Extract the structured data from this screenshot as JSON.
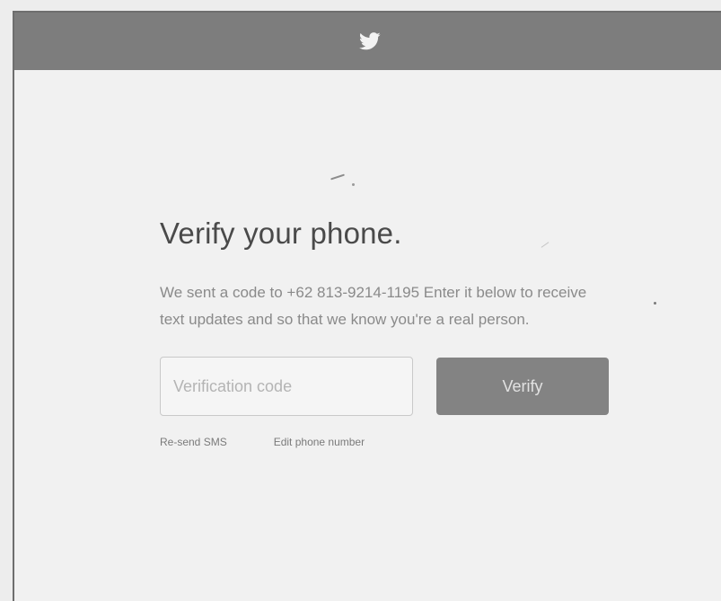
{
  "header": {
    "logo_icon": "twitter-bird-icon",
    "bar_color": "#7d7d7d"
  },
  "verify": {
    "title": "Verify your phone.",
    "description": "We sent a code to +62 813-9214-1195  Enter it below to receive text updates and so that we know you're a real person.",
    "code_input": {
      "placeholder": "Verification code",
      "value": ""
    },
    "verify_button_label": "Verify",
    "resend_link": "Re-send SMS",
    "edit_link": "Edit phone number"
  },
  "colors": {
    "background": "#f1f1f1",
    "button": "#838383",
    "title_text": "#4a4a4a",
    "body_text": "#8a8a8a"
  }
}
